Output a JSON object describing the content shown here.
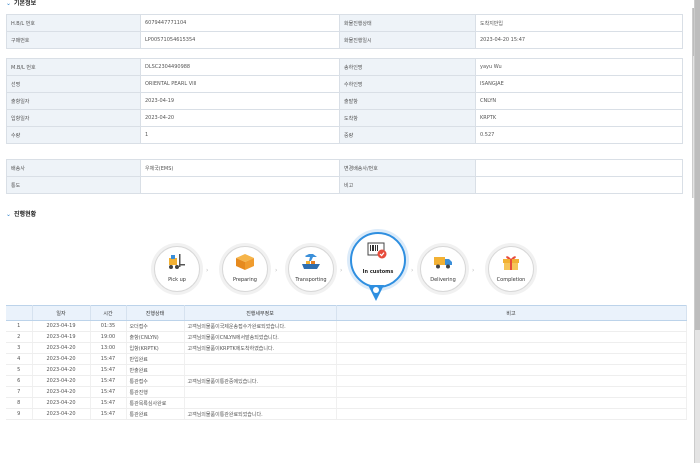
{
  "section1": {
    "arrow": "⌄",
    "title": "기본정보"
  },
  "section2": {
    "arrow": "⌄",
    "title": "진행현황"
  },
  "group1": [
    [
      "H.B/L 번호",
      "6079447771104",
      "화물진행상태",
      "도착지반입"
    ],
    [
      "구매번호",
      "LP00571054615354",
      "화물진행일시",
      "2023-04-20 15:47"
    ]
  ],
  "group2": [
    [
      "M.B/L 번호",
      "DLSC2304490988",
      "송하인명",
      "yayu Wu"
    ],
    [
      "선명",
      "ORIENTAL PEARL VIII",
      "수하인명",
      "ISANGJAE"
    ],
    [
      "출항일자",
      "2023-04-19",
      "출발항",
      "CNLYN"
    ],
    [
      "입항일자",
      "2023-04-20",
      "도착항",
      "KRPTK"
    ],
    [
      "수량",
      "1",
      "중량",
      "0.527"
    ]
  ],
  "group3": [
    [
      "배송사",
      "우체국(EMS)",
      "변경배송사/번호",
      ""
    ],
    [
      "통도",
      "",
      "비고",
      ""
    ]
  ],
  "steps": [
    {
      "label": "Pick up",
      "icon": "forklift-icon",
      "active": false
    },
    {
      "label": "Preparing",
      "icon": "box-icon",
      "active": false
    },
    {
      "label": "Transporting",
      "icon": "ship-plane-icon",
      "active": false
    },
    {
      "label": "In customs",
      "icon": "customs-icon",
      "active": true
    },
    {
      "label": "Delivering",
      "icon": "truck-icon",
      "active": false
    },
    {
      "label": "Completion",
      "icon": "gift-icon",
      "active": false
    }
  ],
  "history": {
    "headers": [
      "",
      "일자",
      "시간",
      "진행상태",
      "진행세부정보",
      "비고"
    ],
    "rows": [
      [
        "1",
        "2023-04-19",
        "01:35",
        "오더접수",
        "고객님의물품이국제운송접수가완료되었습니다.",
        ""
      ],
      [
        "2",
        "2023-04-19",
        "19:00",
        "출항(CNLYN)",
        "고객님의물품이CNLYN에서발송되었습니다.",
        ""
      ],
      [
        "3",
        "2023-04-20",
        "13:00",
        "입항(KRPTK)",
        "고객님의물품이KRPTK에도착하였습니다.",
        ""
      ],
      [
        "4",
        "2023-04-20",
        "15:47",
        "반입완료",
        "",
        ""
      ],
      [
        "5",
        "2023-04-20",
        "15:47",
        "반출완료",
        "",
        ""
      ],
      [
        "6",
        "2023-04-20",
        "15:47",
        "통관접수",
        "고객님의물품이통관중에있습니다.",
        ""
      ],
      [
        "7",
        "2023-04-20",
        "15:47",
        "통관진행",
        "",
        ""
      ],
      [
        "8",
        "2023-04-20",
        "15:47",
        "통관목록심사완료",
        "",
        ""
      ],
      [
        "9",
        "2023-04-20",
        "15:47",
        "통관완료",
        "고객님의물품이통관완료되었습니다.",
        ""
      ]
    ]
  }
}
